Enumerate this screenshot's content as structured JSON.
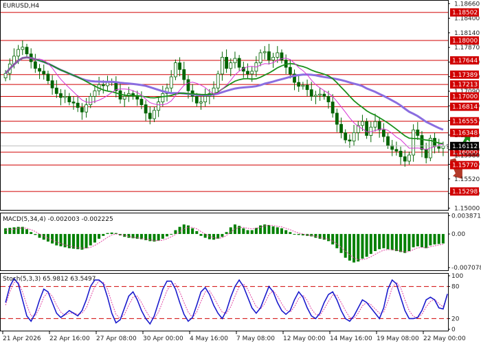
{
  "chart_data": [
    {
      "type": "candlestick",
      "title": "EURUSD,H4",
      "ylim": [
        1.1498,
        1.187
      ],
      "y_ticks": [
        "1.18660",
        "1.18400",
        "1.18140",
        "1.17870",
        "1.17610",
        "1.17350",
        "1.17090",
        "1.16830",
        "1.16570",
        "1.16300",
        "1.16040",
        "1.15780",
        "1.15520",
        "1.15260",
        "1.15000"
      ],
      "levels": [
        1.18502,
        1.18,
        1.17644,
        1.17389,
        1.17213,
        1.17,
        1.16814,
        1.16555,
        1.16348,
        1.16,
        1.1577,
        1.15298
      ],
      "level_labels": [
        "1.18502",
        "1.18000",
        "1.17644",
        "1.17389",
        "1.17213",
        "1.17000",
        "1.16814",
        "1.16555",
        "1.16348",
        "1.16000",
        "1.15770",
        "1.15298"
      ],
      "current_price": 1.16112,
      "current_price_label": "1.16112",
      "extra_tick_label": "1.15980",
      "close": [
        1.1741,
        1.1758,
        1.1772,
        1.1784,
        1.1788,
        1.1776,
        1.1762,
        1.175,
        1.1745,
        1.174,
        1.1728,
        1.1715,
        1.1705,
        1.1698,
        1.17,
        1.169,
        1.1688,
        1.168,
        1.1672,
        1.1685,
        1.17,
        1.171,
        1.1721,
        1.1719,
        1.1725,
        1.1726,
        1.171,
        1.1695,
        1.17,
        1.1705,
        1.17,
        1.1695,
        1.1685,
        1.167,
        1.166,
        1.1675,
        1.169,
        1.1705,
        1.1715,
        1.1735,
        1.176,
        1.1748,
        1.173,
        1.171,
        1.17,
        1.1688,
        1.169,
        1.17,
        1.1705,
        1.1715,
        1.174,
        1.177,
        1.175,
        1.176,
        1.1768,
        1.1752,
        1.1745,
        1.174,
        1.1745,
        1.176,
        1.1778,
        1.178,
        1.1765,
        1.177,
        1.1778,
        1.1765,
        1.1752,
        1.174,
        1.1725,
        1.1718,
        1.172,
        1.1712,
        1.17,
        1.1702,
        1.1704,
        1.17,
        1.169,
        1.167,
        1.165,
        1.1635,
        1.1622,
        1.162,
        1.1635,
        1.1648,
        1.1655,
        1.163,
        1.1645,
        1.1655,
        1.164,
        1.1628,
        1.1612,
        1.1605,
        1.1602,
        1.1592,
        1.1584,
        1.1595,
        1.164,
        1.163,
        1.1605,
        1.159,
        1.1625,
        1.161,
        1.1607,
        1.1611
      ],
      "x_labels": [
        "21 Apr 2026",
        "22 Apr 16:00",
        "27 Apr 08:00",
        "30 Apr 00:00",
        "4 May 16:00",
        "7 May 08:00",
        "12 May 00:00",
        "14 May 16:00",
        "19 May 08:00",
        "22 May 00:00"
      ],
      "indicators": [
        "moving-average-fast",
        "moving-average-mid",
        "moving-average-slow"
      ],
      "colors": {
        "up": "#006400",
        "down": "#006400",
        "ma_fast": "#d633d6",
        "ma_mid": "#1a8f1a",
        "ma_slow": "#8a6de0",
        "level": "#d00000",
        "arrow_up": "#1a8f1a",
        "arrow_down": "#b33a2a"
      }
    },
    {
      "type": "histogram",
      "title": "MACD(5,34,4) -0.002003 -0.002225",
      "ylim": [
        -0.0075,
        0.0042
      ],
      "y_ticks": [
        "0.003871",
        "0.00",
        "-0.007078"
      ],
      "values": [
        0.0012,
        0.0013,
        0.0014,
        0.0015,
        0.0015,
        0.001,
        0.0004,
        -0.0002,
        -0.0008,
        -0.0012,
        -0.0016,
        -0.002,
        -0.0024,
        -0.0026,
        -0.0028,
        -0.003,
        -0.0031,
        -0.0032,
        -0.0033,
        -0.003,
        -0.0024,
        -0.0018,
        -0.001,
        -0.0004,
        0.0002,
        0.0003,
        0.0002,
        -0.0003,
        -0.0006,
        -0.0008,
        -0.0009,
        -0.001,
        -0.0011,
        -0.0013,
        -0.0015,
        -0.0016,
        -0.0014,
        -0.001,
        -0.0005,
        0.0,
        0.0008,
        0.0015,
        0.002,
        0.0018,
        0.0012,
        0.0006,
        -0.0004,
        -0.0008,
        -0.0011,
        -0.0012,
        -0.001,
        -0.0006,
        0.0004,
        0.0014,
        0.002,
        0.0017,
        0.0012,
        0.0008,
        0.0008,
        0.0013,
        0.0018,
        0.002,
        0.0019,
        0.0016,
        0.0014,
        0.0012,
        0.0008,
        0.0004,
        0.0,
        -0.0002,
        -0.0003,
        -0.0004,
        -0.0005,
        -0.0008,
        -0.001,
        -0.0012,
        -0.0015,
        -0.0022,
        -0.003,
        -0.004,
        -0.005,
        -0.0056,
        -0.006,
        -0.0058,
        -0.0052,
        -0.0048,
        -0.0042,
        -0.0036,
        -0.0032,
        -0.003,
        -0.0032,
        -0.0034,
        -0.0036,
        -0.0038,
        -0.004,
        -0.0036,
        -0.0028,
        -0.0026,
        -0.0028,
        -0.003,
        -0.0024,
        -0.0022,
        -0.0021,
        -0.002
      ],
      "signal": [
        0.0008,
        0.0009,
        0.001,
        0.0012,
        0.0013,
        0.0012,
        0.0009,
        0.0005,
        0.0,
        -0.0005,
        -0.0009,
        -0.0013,
        -0.0017,
        -0.002,
        -0.0023,
        -0.0025,
        -0.0027,
        -0.0029,
        -0.003,
        -0.003,
        -0.0028,
        -0.0024,
        -0.0019,
        -0.0013,
        -0.0007,
        -0.0002,
        0.0,
        -0.0001,
        -0.0003,
        -0.0005,
        -0.0007,
        -0.0008,
        -0.0009,
        -0.0011,
        -0.0012,
        -0.0014,
        -0.0014,
        -0.0013,
        -0.001,
        -0.0006,
        -0.0001,
        0.0005,
        0.0011,
        0.0014,
        0.0014,
        0.0011,
        0.0005,
        0.0,
        -0.0005,
        -0.0008,
        -0.0009,
        -0.0008,
        -0.0003,
        0.0004,
        0.0011,
        0.0014,
        0.0014,
        0.0012,
        0.0011,
        0.0012,
        0.0014,
        0.0017,
        0.0018,
        0.0018,
        0.0016,
        0.0015,
        0.0012,
        0.0009,
        0.0005,
        0.0002,
        0.0,
        -0.0002,
        -0.0003,
        -0.0005,
        -0.0007,
        -0.0009,
        -0.0011,
        -0.0015,
        -0.0021,
        -0.0028,
        -0.0036,
        -0.0044,
        -0.005,
        -0.0054,
        -0.0054,
        -0.0052,
        -0.0048,
        -0.0043,
        -0.0038,
        -0.0034,
        -0.0033,
        -0.0033,
        -0.0034,
        -0.0036,
        -0.0038,
        -0.0037,
        -0.0033,
        -0.0029,
        -0.0028,
        -0.0029,
        -0.0027,
        -0.0025,
        -0.0023,
        -0.0022
      ],
      "colors": {
        "bars": "#008000",
        "signal": "#e040a0"
      }
    },
    {
      "type": "line",
      "title": "Stoch(5,3,3) 65.9812 63.5497",
      "ylim": [
        0,
        100
      ],
      "y_ticks": [
        "100",
        "80",
        "20",
        "0"
      ],
      "levels": [
        80,
        20
      ],
      "main": [
        50,
        80,
        95,
        85,
        55,
        25,
        15,
        30,
        55,
        75,
        70,
        50,
        30,
        22,
        28,
        35,
        30,
        25,
        35,
        55,
        80,
        92,
        92,
        85,
        60,
        30,
        12,
        18,
        40,
        62,
        70,
        55,
        35,
        20,
        10,
        25,
        50,
        75,
        90,
        90,
        75,
        50,
        28,
        15,
        22,
        45,
        70,
        78,
        65,
        45,
        30,
        20,
        35,
        60,
        80,
        92,
        80,
        60,
        40,
        30,
        40,
        60,
        80,
        70,
        50,
        35,
        28,
        35,
        55,
        70,
        60,
        40,
        25,
        20,
        30,
        50,
        65,
        70,
        55,
        35,
        20,
        15,
        25,
        40,
        55,
        50,
        40,
        30,
        20,
        40,
        75,
        92,
        85,
        60,
        35,
        20,
        20,
        22,
        35,
        55,
        60,
        55,
        40,
        38,
        66
      ],
      "signal": [
        45,
        70,
        88,
        88,
        70,
        45,
        25,
        25,
        40,
        60,
        70,
        62,
        45,
        32,
        26,
        30,
        31,
        28,
        30,
        40,
        60,
        80,
        90,
        88,
        75,
        50,
        28,
        20,
        28,
        45,
        60,
        62,
        50,
        35,
        22,
        20,
        32,
        52,
        72,
        85,
        85,
        70,
        50,
        32,
        22,
        32,
        52,
        70,
        72,
        60,
        45,
        32,
        30,
        42,
        62,
        80,
        85,
        75,
        58,
        42,
        38,
        48,
        65,
        72,
        62,
        48,
        36,
        32,
        42,
        58,
        64,
        54,
        38,
        28,
        26,
        38,
        52,
        64,
        64,
        50,
        35,
        22,
        20,
        30,
        44,
        50,
        46,
        38,
        30,
        32,
        52,
        78,
        88,
        78,
        55,
        35,
        24,
        22,
        28,
        42,
        52,
        56,
        48,
        42,
        63
      ],
      "colors": {
        "main": "#1a1acc",
        "signal": "#e040a0",
        "level": "#d00000"
      }
    }
  ]
}
